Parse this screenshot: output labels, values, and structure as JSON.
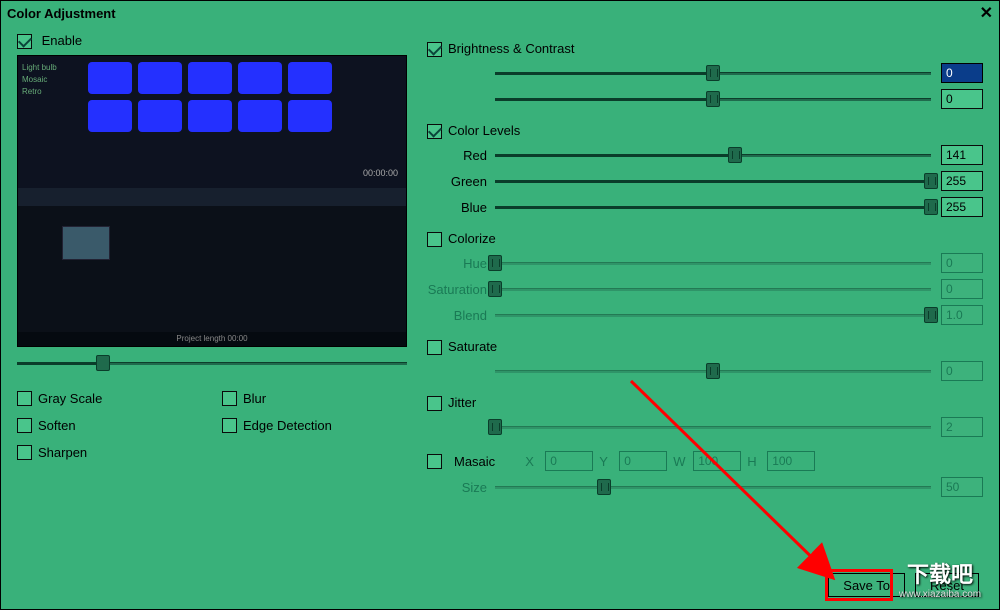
{
  "title": "Color Adjustment",
  "enable_label": "Enable",
  "preview": {
    "timecode": "00:00:00",
    "side_text": "Light bulb\nMosaic\nRetro",
    "footer": "Project length  00:00"
  },
  "preview_slider_pct": 22,
  "fx": {
    "gray_scale": "Gray Scale",
    "blur": "Blur",
    "soften": "Soften",
    "edge_detection": "Edge Detection",
    "sharpen": "Sharpen"
  },
  "sections": {
    "brightness": {
      "title": "Brightness & Contrast",
      "brightness_pct": 50,
      "brightness_val": "0",
      "contrast_pct": 50,
      "contrast_val": "0"
    },
    "levels": {
      "title": "Color Levels",
      "red_label": "Red",
      "red_pct": 55,
      "red_val": "141",
      "green_label": "Green",
      "green_pct": 100,
      "green_val": "255",
      "blue_label": "Blue",
      "blue_pct": 100,
      "blue_val": "255"
    },
    "colorize": {
      "title": "Colorize",
      "hue_label": "Hue",
      "hue_pct": 0,
      "hue_val": "0",
      "sat_label": "Saturation",
      "sat_pct": 0,
      "sat_val": "0",
      "blend_label": "Blend",
      "blend_pct": 100,
      "blend_val": "1.0"
    },
    "saturate": {
      "title": "Saturate",
      "pct": 50,
      "val": "0"
    },
    "jitter": {
      "title": "Jitter",
      "pct": 0,
      "val": "2"
    },
    "mosaic": {
      "title": "Masaic",
      "x_label": "X",
      "x_val": "0",
      "y_label": "Y",
      "y_val": "0",
      "w_label": "W",
      "w_val": "100",
      "h_label": "H",
      "h_val": "100",
      "size_label": "Size",
      "size_pct": 25,
      "size_val": "50"
    }
  },
  "buttons": {
    "save_to": "Save To",
    "reset": "Reset"
  },
  "watermark": {
    "text": "下载吧",
    "url": "www.xiazaiba.com"
  }
}
